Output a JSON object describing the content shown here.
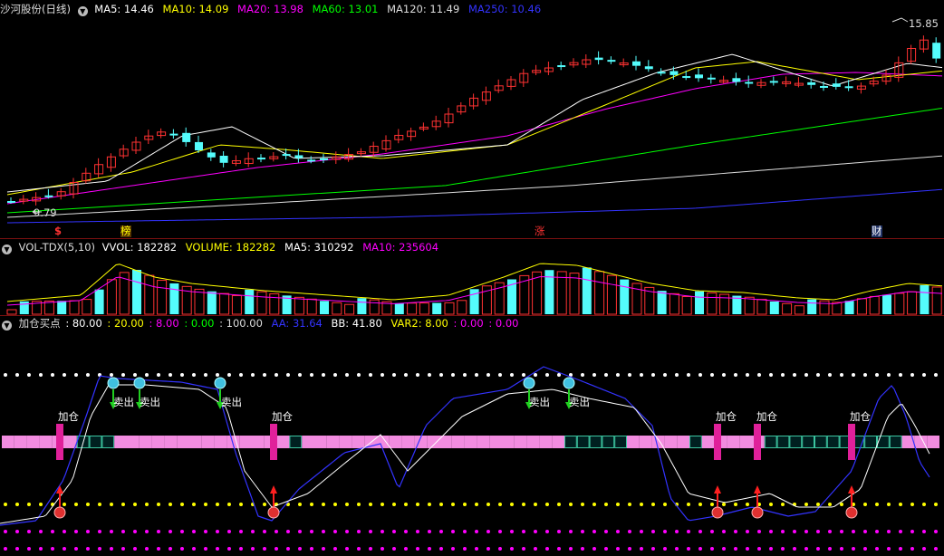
{
  "price_panel": {
    "header": {
      "title": "沙河股份(日线)",
      "ma": [
        {
          "label": "MA5: 14.46",
          "color": "#ffffff"
        },
        {
          "label": "MA10: 14.09",
          "color": "#ffff00"
        },
        {
          "label": "MA20: 13.98",
          "color": "#ff00ff"
        },
        {
          "label": "MA60: 13.01",
          "color": "#00ff00"
        },
        {
          "label": "MA120: 11.49",
          "color": "#dddddd"
        },
        {
          "label": "MA250: 10.46",
          "color": "#3333ff"
        }
      ]
    },
    "high_label": "15.85",
    "low_label": "9.79",
    "events": [
      {
        "label": "$",
        "color": "#ff3333"
      },
      {
        "label": "榜",
        "color": "#ffff00"
      },
      {
        "label": "涨",
        "color": "#ff3333"
      },
      {
        "label": "财",
        "color": "#ffffff"
      }
    ]
  },
  "volume_panel": {
    "header": [
      {
        "label": "VOL-TDX(5,10)",
        "color": "#dddddd"
      },
      {
        "label": "VVOL: 182282",
        "color": "#ffffff"
      },
      {
        "label": "VOLUME: 182282",
        "color": "#ffff00"
      },
      {
        "label": "MA5: 310292",
        "color": "#ffffff"
      },
      {
        "label": "MA10: 235604",
        "color": "#ff00ff"
      }
    ]
  },
  "indicator_panel": {
    "header": [
      {
        "label": "加仓买点",
        "color": "#dddddd"
      },
      {
        "label": ": 80.00",
        "color": "#ffffff"
      },
      {
        "label": ": 20.00",
        "color": "#ffff00"
      },
      {
        "label": ": 8.00",
        "color": "#ff00ff"
      },
      {
        "label": ": 0.00",
        "color": "#00ff00"
      },
      {
        "label": ": 100.00",
        "color": "#dddddd"
      },
      {
        "label": "AA: 31.64",
        "color": "#3333ff"
      },
      {
        "label": "BB: 41.80",
        "color": "#ffffff"
      },
      {
        "label": "VAR2: 8.00",
        "color": "#ffff00"
      },
      {
        "label": ": 0.00",
        "color": "#ff00ff"
      },
      {
        "label": ": 0.00",
        "color": "#ff00ff"
      }
    ],
    "add_label": "加仓",
    "sell_label": "卖出"
  },
  "colors": {
    "up": "#ff3232",
    "down": "#54fcfc",
    "divider": "#7a1010",
    "ma5": "#ffffff",
    "ma10": "#ffff00",
    "ma20": "#ff00ff",
    "ma60": "#00ff00",
    "ma120": "#dddddd",
    "ma250": "#3333ff"
  }
}
